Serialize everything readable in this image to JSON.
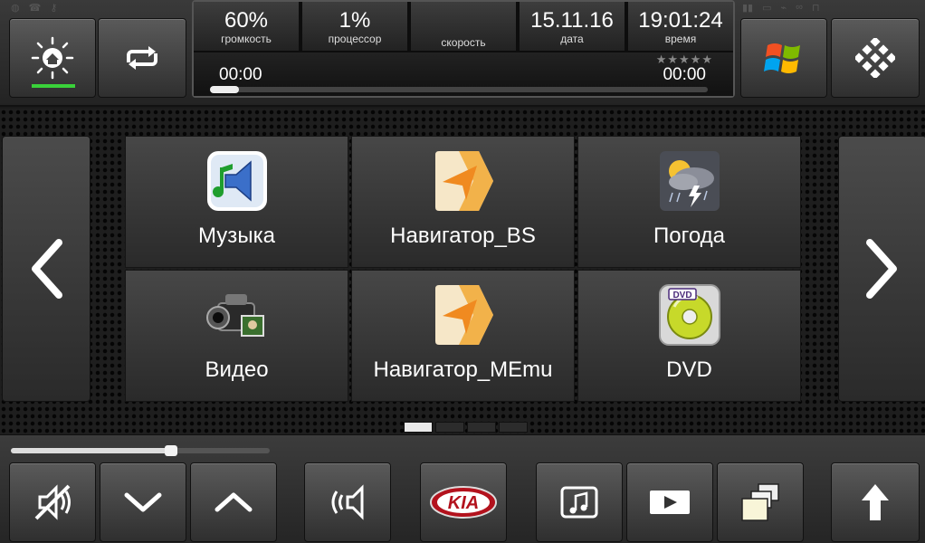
{
  "status": {
    "volume": {
      "value": "60%",
      "label": "громкость"
    },
    "cpu": {
      "value": "1%",
      "label": "процессор"
    },
    "speed": {
      "value": "",
      "label": "скорость"
    },
    "date": {
      "value": "15.11.16",
      "label": "дата"
    },
    "time": {
      "value": "19:01:24",
      "label": "время"
    }
  },
  "player": {
    "elapsed": "00:00",
    "total": "00:00",
    "rating_stars": "★★★★★",
    "progress": 0.02
  },
  "tiles": [
    {
      "label": "Музыка",
      "icon": "music-speaker-icon"
    },
    {
      "label": "Навигатор_BS",
      "icon": "navigator-arrow-icon"
    },
    {
      "label": "Погода",
      "icon": "weather-storm-icon"
    },
    {
      "label": "Видео",
      "icon": "video-camera-icon"
    },
    {
      "label": "Навигатор_MEmu",
      "icon": "navigator-arrow-icon"
    },
    {
      "label": "DVD",
      "icon": "dvd-disc-icon"
    }
  ],
  "pager": {
    "pages": 4,
    "active": 0
  },
  "bottom": {
    "volume_level": 0.6,
    "kia_logo": "KIA"
  },
  "colors": {
    "accent_green": "#3ad13a",
    "nav_orange": "#f29a2e"
  }
}
